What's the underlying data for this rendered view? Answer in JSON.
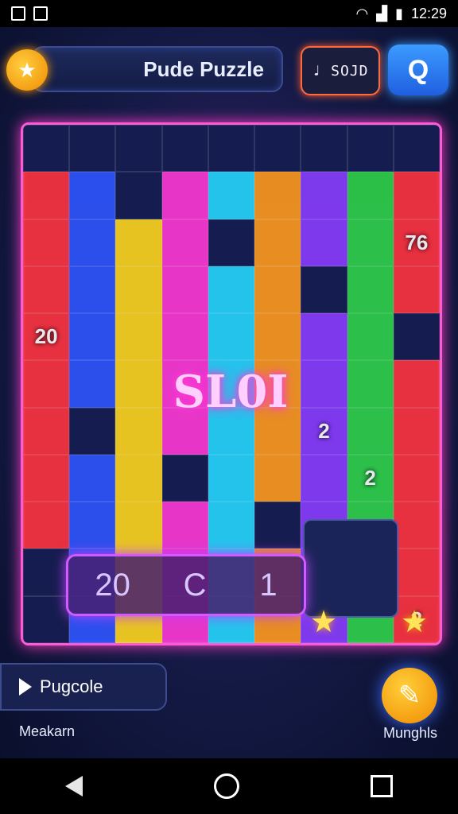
{
  "status_bar": {
    "time": "12:29"
  },
  "header": {
    "title": "Pude Puzzle",
    "score_label": "♩ SOJD",
    "hint_icon": "hint-icon"
  },
  "board": {
    "center_score": "SL0I",
    "cell_numbers": [
      "20",
      "2",
      "76",
      "2",
      "1",
      "2"
    ],
    "tray_items": [
      "20",
      "C",
      "1"
    ],
    "colors": {
      "red": "#ff3340",
      "orange": "#ff9a1f",
      "yellow": "#ffd61f",
      "green": "#2fd24a",
      "cyan": "#27d6ff",
      "blue": "#2f56ff",
      "purple": "#8a3dff",
      "magenta": "#ff3ad6"
    }
  },
  "bottom": {
    "play_label": "Pugcole",
    "left_label": "Meakarn",
    "right_label": "Munghls"
  }
}
